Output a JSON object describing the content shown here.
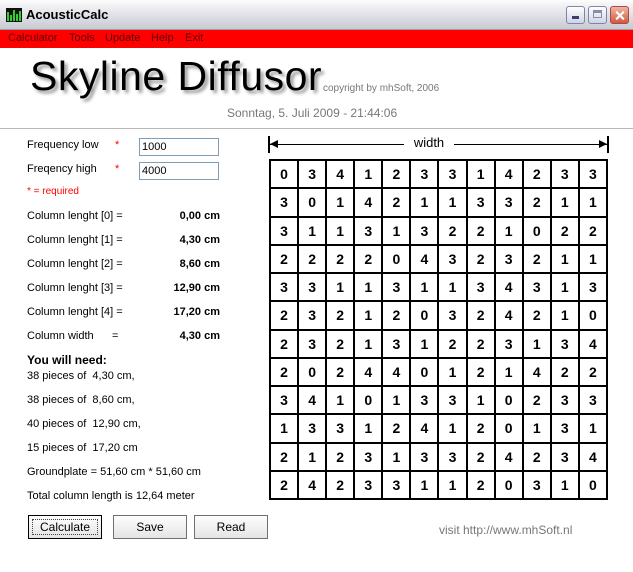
{
  "window": {
    "title": "AcousticCalc"
  },
  "menu": [
    "Calculator",
    "Tools",
    "Update",
    "Help",
    "Exit"
  ],
  "header": {
    "heading": "Skyline Diffusor",
    "copyright": "copyright by mhSoft, 2006",
    "date": "Sonntag, 5. Juli 2009 - 21:44:06"
  },
  "form": {
    "freq_low_label": "Frequency low",
    "freq_low_value": "1000",
    "freq_high_label": "Freqency high",
    "freq_high_value": "4000",
    "required_star": "*",
    "required_note": "* = required"
  },
  "columns": [
    {
      "label": "Column lenght [0] =",
      "value": "0,00 cm"
    },
    {
      "label": "Column lenght [1] =",
      "value": "4,30 cm"
    },
    {
      "label": "Column lenght [2] =",
      "value": "8,60 cm"
    },
    {
      "label": "Column lenght [3] =",
      "value": "12,90 cm"
    },
    {
      "label": "Column lenght [4] =",
      "value": "17,20 cm"
    },
    {
      "label": "Column width      =",
      "value": "4,30 cm"
    }
  ],
  "needs": {
    "title": "You will need:",
    "lines": [
      "38 pieces of  4,30 cm,",
      "38 pieces of  8,60 cm,",
      "40 pieces of  12,90 cm,",
      "15 pieces of  17,20 cm",
      "Groundplate = 51,60 cm * 51,60 cm",
      "Total column length is 12,64 meter"
    ]
  },
  "buttons": {
    "calculate": "Calculate",
    "save": "Save",
    "read": "Read"
  },
  "ruler": {
    "label": "width"
  },
  "grid": [
    [
      "0",
      "3",
      "4",
      "1",
      "2",
      "3",
      "3",
      "1",
      "4",
      "2",
      "3",
      "3"
    ],
    [
      "3",
      "0",
      "1",
      "4",
      "2",
      "1",
      "1",
      "3",
      "3",
      "2",
      "1",
      "1"
    ],
    [
      "3",
      "1",
      "1",
      "3",
      "1",
      "3",
      "2",
      "2",
      "1",
      "0",
      "2",
      "2"
    ],
    [
      "2",
      "2",
      "2",
      "2",
      "0",
      "4",
      "3",
      "2",
      "3",
      "2",
      "1",
      "1"
    ],
    [
      "3",
      "3",
      "1",
      "1",
      "3",
      "1",
      "1",
      "3",
      "4",
      "3",
      "1",
      "3"
    ],
    [
      "2",
      "3",
      "2",
      "1",
      "2",
      "0",
      "3",
      "2",
      "4",
      "2",
      "1",
      "0"
    ],
    [
      "2",
      "3",
      "2",
      "1",
      "3",
      "1",
      "2",
      "2",
      "3",
      "1",
      "3",
      "4"
    ],
    [
      "2",
      "0",
      "2",
      "4",
      "4",
      "0",
      "1",
      "2",
      "1",
      "4",
      "2",
      "2"
    ],
    [
      "3",
      "4",
      "1",
      "0",
      "1",
      "3",
      "3",
      "1",
      "0",
      "2",
      "3",
      "3"
    ],
    [
      "1",
      "3",
      "3",
      "1",
      "2",
      "4",
      "1",
      "2",
      "0",
      "1",
      "3",
      "1"
    ],
    [
      "2",
      "1",
      "2",
      "3",
      "1",
      "3",
      "3",
      "2",
      "4",
      "2",
      "3",
      "4"
    ],
    [
      "2",
      "4",
      "2",
      "3",
      "3",
      "1",
      "1",
      "2",
      "0",
      "3",
      "1",
      "0"
    ]
  ],
  "footer": {
    "visit": "visit http://www.mhSoft.nl"
  },
  "colors": {
    "menubar": "#ff0000",
    "required": "#ff0000"
  }
}
